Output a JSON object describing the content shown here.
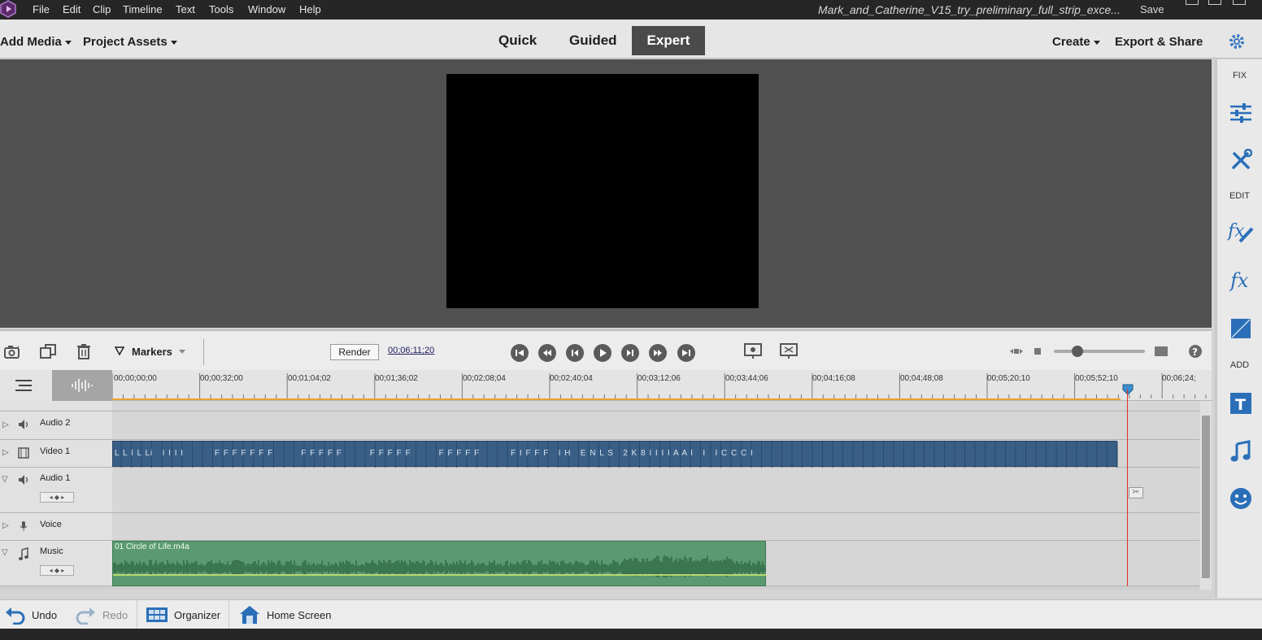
{
  "menu": {
    "items": [
      "File",
      "Edit",
      "Clip",
      "Timeline",
      "Text",
      "Tools",
      "Window",
      "Help"
    ],
    "document_title": "Mark_and_Catherine_V15_try_preliminary_full_strip_exce...",
    "save_label": "Save"
  },
  "modebar": {
    "add_media": "Add Media",
    "project_assets": "Project Assets",
    "tabs": [
      "Quick",
      "Guided",
      "Expert"
    ],
    "active_tab": "Expert",
    "create": "Create",
    "export_share": "Export & Share"
  },
  "right_panel": {
    "fix_label": "FIX",
    "edit_label": "EDIT",
    "add_label": "ADD"
  },
  "timeline_toolbar": {
    "markers_label": "Markers",
    "render_label": "Render",
    "timecode": "00;06;11;20"
  },
  "ruler": {
    "ticks": [
      "00;00;00;00",
      "00;00;32;00",
      "00;01;04;02",
      "00;01;36;02",
      "00;02;08;04",
      "00;02;40;04",
      "00;03;12;06",
      "00;03;44;06",
      "00;04;16;08",
      "00;04;48;08",
      "00;05;20;10",
      "00;05;52;10",
      "00;06;24;"
    ]
  },
  "tracks": {
    "audio2": "Audio 2",
    "video1": "Video 1",
    "audio1": "Audio 1",
    "voice": "Voice",
    "music": "Music",
    "video_clip_text": "L L I L Li   I I I I          F F F F F F F         F F F F F         F F F F F         F F F F F          F I F F F   I H   E N L S   2 K 8 I I I I A A I   I   I C C C I",
    "music_clip_name": "01 Circle of Life.m4a"
  },
  "bottombar": {
    "undo": "Undo",
    "redo": "Redo",
    "organizer": "Organizer",
    "home_screen": "Home Screen"
  },
  "colors": {
    "accent_tab": "#4a4a4a",
    "video_clip": "#3a5f86",
    "music_clip": "#5b9a70",
    "playhead": "#e03030",
    "work_area": "#f0a030"
  }
}
